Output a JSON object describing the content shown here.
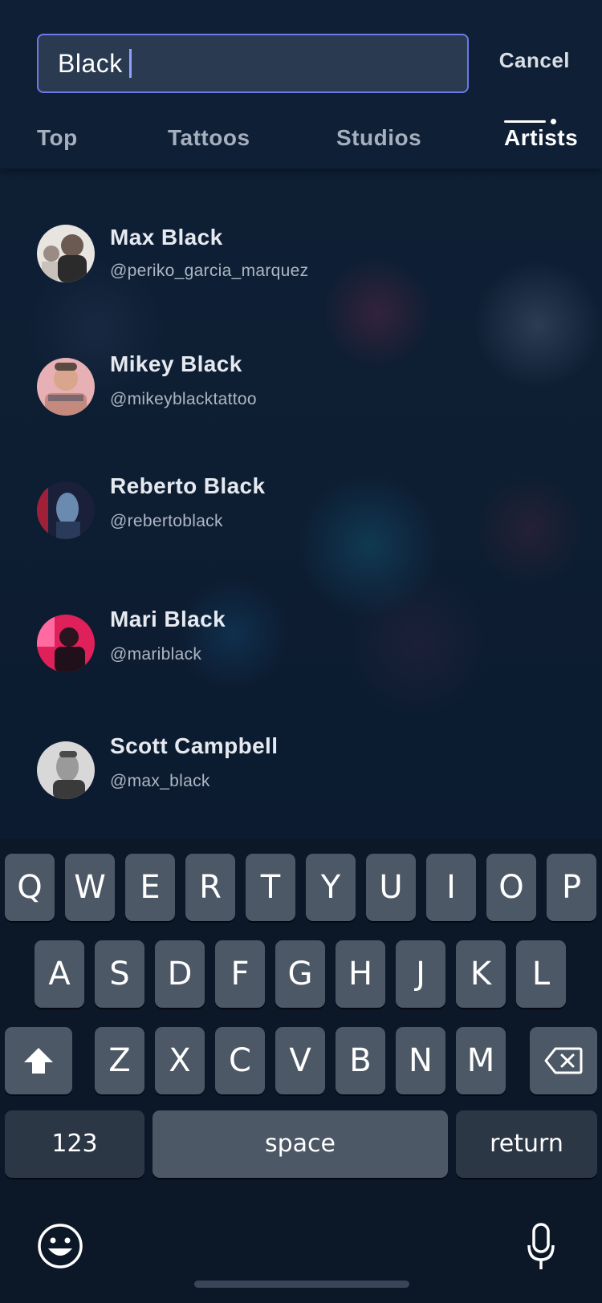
{
  "search": {
    "value": "Black"
  },
  "header": {
    "cancel_label": "Cancel"
  },
  "tabs": [
    {
      "label": "Top",
      "active": false
    },
    {
      "label": "Tattoos",
      "active": false
    },
    {
      "label": "Studios",
      "active": false
    },
    {
      "label": "Artists",
      "active": true
    }
  ],
  "results": [
    {
      "name": "Max Black",
      "handle": "@periko_garcia_marquez"
    },
    {
      "name": "Mikey Black",
      "handle": "@mikeyblacktattoo"
    },
    {
      "name": "Reberto Black",
      "handle": "@rebertoblack"
    },
    {
      "name": "Mari Black",
      "handle": "@mariblack"
    },
    {
      "name": "Scott Campbell",
      "handle": "@max_black"
    }
  ],
  "keyboard": {
    "row1": [
      "Q",
      "W",
      "E",
      "R",
      "T",
      "Y",
      "U",
      "I",
      "O",
      "P"
    ],
    "row2": [
      "A",
      "S",
      "D",
      "F",
      "G",
      "H",
      "J",
      "K",
      "L"
    ],
    "row3": [
      "Z",
      "X",
      "C",
      "V",
      "B",
      "N",
      "M"
    ],
    "numbers_label": "123",
    "space_label": "space",
    "return_label": "return"
  },
  "icons": {
    "shift": "shift-icon",
    "backspace": "backspace-icon",
    "emoji": "emoji-icon",
    "mic": "microphone-icon"
  },
  "colors": {
    "accent": "#6b7ae8",
    "background": "#0d1a2e",
    "key": "#4d5866",
    "key_dark": "#2c3746"
  }
}
